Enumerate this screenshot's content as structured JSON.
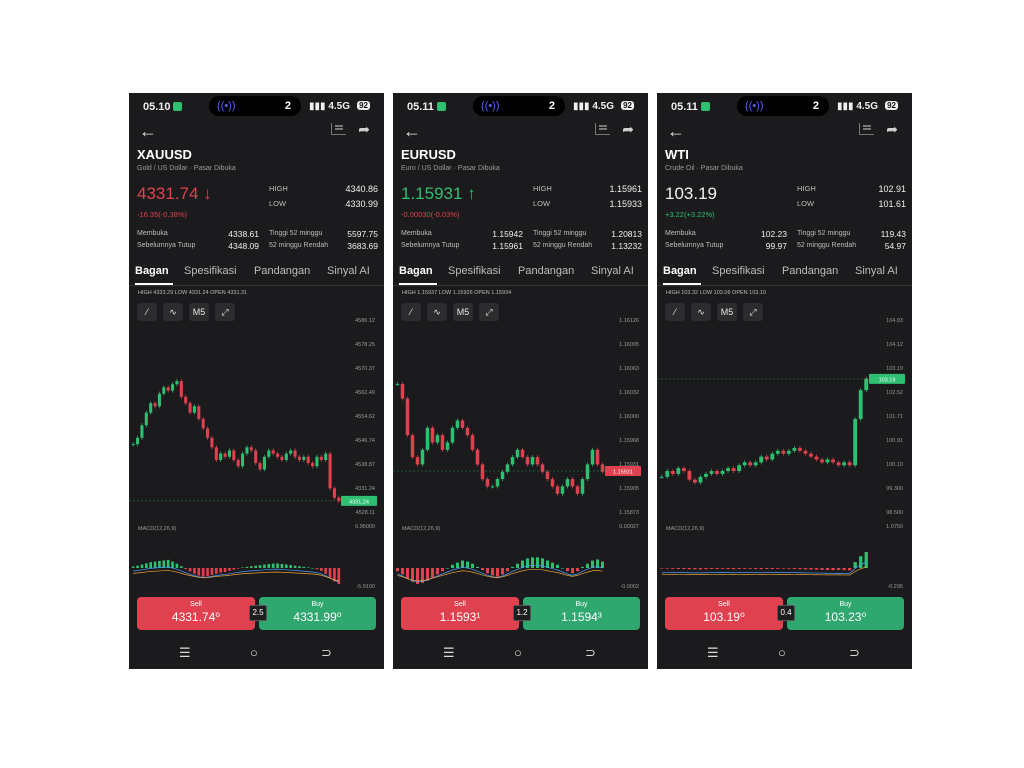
{
  "screens": [
    {
      "status": {
        "time": "05.10",
        "island_count": "2",
        "network": "4.5G",
        "battery": "92"
      },
      "symbol": "XAUUSD",
      "subtitle": "Gold / US Dollar · Pasar Dibuka",
      "price": "4331.74",
      "price_arrow": "↓",
      "change": "-16.35(-0.38%)",
      "trend": "down",
      "high_label": "HIGH",
      "high": "4340.86",
      "low_label": "LOW",
      "low": "4330.99",
      "stats": {
        "open_label": "Membuka",
        "open": "4338.61",
        "prev_label": "Sebelumnya Tutup",
        "prev": "4348.09",
        "hi52_label": "Tinggi 52 minggu",
        "hi52": "5597.75",
        "lo52_label": "52 minggu Rendah",
        "lo52": "3683.69"
      },
      "tabs": [
        "Bagan",
        "Spesifikasi",
        "Pandangan",
        "Sinyal AI"
      ],
      "ohlc": "HIGH 4333.29  LOW 4331.24  OPEN 4331.31",
      "tools": [
        "⁄",
        "∿",
        "M5",
        "⤢"
      ],
      "chart": {
        "y_labels": [
          "4586.12",
          "4578.25",
          "4570.37",
          "4562.49",
          "4554.62",
          "4546.74",
          "4538.87",
          "4331.24",
          "4528.11"
        ],
        "price_tag": "4331.24",
        "macd_label": "MACD(12,26,9)",
        "macd_top": "6.95009",
        "macd_bottom": "-5.9100",
        "series": [
          4550,
          4552,
          4556,
          4560,
          4563,
          4562,
          4566,
          4568,
          4567,
          4569,
          4570,
          4565,
          4563,
          4560,
          4562,
          4558,
          4555,
          4552,
          4549,
          4545,
          4547,
          4546,
          4548,
          4545,
          4543,
          4547,
          4549,
          4548,
          4544,
          4542,
          4546,
          4548,
          4547,
          4546,
          4545,
          4547,
          4548,
          4546,
          4545,
          4546,
          4544,
          4543,
          4546,
          4545,
          4547,
          4536,
          4533,
          4532
        ],
        "tag_value": 4532,
        "ymin": 4525,
        "ymax": 4590,
        "macd": [
          0.5,
          0.8,
          1.2,
          1.6,
          2.0,
          2.2,
          2.4,
          2.6,
          2.8,
          2.2,
          1.5,
          0.6,
          -0.4,
          -1.2,
          -2.0,
          -2.6,
          -3.0,
          -2.8,
          -2.4,
          -2.0,
          -1.6,
          -1.4,
          -1.0,
          -0.6,
          -0.2,
          0.2,
          0.4,
          0.6,
          0.8,
          1.0,
          1.2,
          1.4,
          1.5,
          1.6,
          1.4,
          1.2,
          1.0,
          0.8,
          0.6,
          0.4,
          0.2,
          0.0,
          -0.4,
          -1.0,
          -2.0,
          -3.4,
          -4.6,
          -5.5
        ]
      },
      "sell_label": "Sell",
      "sell_price": "4331.74⁰",
      "buy_label": "Buy",
      "buy_price": "4331.99⁰",
      "spread": "2.5",
      "nav": [
        "☰",
        "○",
        "⊃"
      ]
    },
    {
      "status": {
        "time": "05.11",
        "island_count": "2",
        "network": "4.5G",
        "battery": "92"
      },
      "symbol": "EURUSD",
      "subtitle": "Euro / US Dollar · Pasar Dibuka",
      "price": "1.15931",
      "price_arrow": "↑",
      "change": "-0.00030(-0.03%)",
      "trend": "up",
      "high_label": "HIGH",
      "high": "1.15961",
      "low_label": "LOW",
      "low": "1.15933",
      "stats": {
        "open_label": "Membuka",
        "open": "1.15942",
        "prev_label": "Sebelumnya Tutup",
        "prev": "1.15961",
        "hi52_label": "Tinggi 52 minggu",
        "hi52": "1.20813",
        "lo52_label": "52 minggu Rendah",
        "lo52": "1.13232"
      },
      "tabs": [
        "Bagan",
        "Spesifikasi",
        "Pandangan",
        "Sinyal AI"
      ],
      "ohlc": "HIGH 1.15937  LOW 1.15926  OPEN 1.15934",
      "tools": [
        "⁄",
        "∿",
        "M5",
        "⤢"
      ],
      "chart": {
        "y_labels": [
          "1.16126",
          "1.16095",
          "1.16063",
          "1.16032",
          "1.16000",
          "1.15968",
          "1.15931",
          "1.15905",
          "1.15873"
        ],
        "price_tag": "1.15931",
        "macd_label": "MACD(12,26,9)",
        "macd_top": "0.00027",
        "macd_bottom": "-0.0002",
        "series": [
          1.1605,
          1.1603,
          1.1598,
          1.1595,
          1.1594,
          1.1596,
          1.1599,
          1.1597,
          1.1598,
          1.1596,
          1.1597,
          1.1599,
          1.16,
          1.1599,
          1.1598,
          1.1596,
          1.1594,
          1.1592,
          1.1591,
          1.1591,
          1.1592,
          1.1593,
          1.1594,
          1.1595,
          1.1596,
          1.1595,
          1.1594,
          1.1595,
          1.1594,
          1.1593,
          1.1592,
          1.1591,
          1.159,
          1.1591,
          1.1592,
          1.1591,
          1.159,
          1.1592,
          1.1594,
          1.1596,
          1.1594,
          1.1593
        ],
        "tag_value": 1.15931,
        "ymin": 1.1586,
        "ymax": 1.1614,
        "macd": [
          -0.3,
          -0.6,
          -1.0,
          -1.3,
          -1.5,
          -1.4,
          -1.2,
          -0.9,
          -0.6,
          -0.3,
          0.0,
          0.3,
          0.5,
          0.7,
          0.6,
          0.4,
          0.1,
          -0.2,
          -0.5,
          -0.7,
          -0.8,
          -0.6,
          -0.3,
          0.1,
          0.4,
          0.7,
          0.9,
          1.0,
          1.0,
          0.9,
          0.7,
          0.5,
          0.3,
          0.0,
          -0.3,
          -0.5,
          -0.3,
          0.1,
          0.4,
          0.7,
          0.8,
          0.6
        ]
      },
      "sell_label": "Sell",
      "sell_price": "1.1593¹",
      "buy_label": "Buy",
      "buy_price": "1.1594³",
      "spread": "1.2",
      "nav": [
        "☰",
        "○",
        "⊃"
      ]
    },
    {
      "status": {
        "time": "05.11",
        "island_count": "2",
        "network": "4.5G",
        "battery": "92"
      },
      "symbol": "WTI",
      "subtitle": "Crude Oil · Pasar Dibuka",
      "price": "103.19",
      "price_arrow": "",
      "change": "+3.22(+3.22%)",
      "trend": "flat",
      "high_label": "HIGH",
      "high": "102.91",
      "low_label": "LOW",
      "low": "101.61",
      "stats": {
        "open_label": "Membuka",
        "open": "102.23",
        "prev_label": "Sebelumnya Tutup",
        "prev": "99.97",
        "hi52_label": "Tinggi 52 minggu",
        "hi52": "119.43",
        "lo52_label": "52 minggu Rendah",
        "lo52": "54.97"
      },
      "tabs": [
        "Bagan",
        "Spesifikasi",
        "Pandangan",
        "Sinyal AI"
      ],
      "ohlc": "HIGH 103.32  LOW 103.06  OPEN 103.10",
      "tools": [
        "⁄",
        "∿",
        "M5",
        "⤢"
      ],
      "chart": {
        "y_labels": [
          "104.93",
          "104.12",
          "103.19",
          "102.52",
          "101.71",
          "100.91",
          "100.10",
          "99.300",
          "98.500"
        ],
        "price_tag": "103.19",
        "macd_label": "MACD(12,26,9)",
        "macd_top": "1.0750",
        "macd_bottom": "-0.295",
        "series": [
          99.8,
          100.0,
          99.9,
          100.1,
          100.0,
          99.7,
          99.6,
          99.8,
          99.9,
          100.0,
          99.9,
          100.0,
          100.1,
          100.0,
          100.2,
          100.3,
          100.2,
          100.3,
          100.5,
          100.4,
          100.6,
          100.7,
          100.6,
          100.7,
          100.8,
          100.7,
          100.6,
          100.5,
          100.4,
          100.3,
          100.4,
          100.3,
          100.2,
          100.3,
          100.2,
          101.8,
          102.8,
          103.2
        ],
        "tag_value": 103.19,
        "ymin": 98.2,
        "ymax": 105.3,
        "macd": [
          -0.02,
          -0.04,
          -0.05,
          -0.06,
          -0.06,
          -0.07,
          -0.08,
          -0.08,
          -0.07,
          -0.06,
          -0.06,
          -0.05,
          -0.06,
          -0.07,
          -0.06,
          -0.05,
          -0.05,
          -0.06,
          -0.07,
          -0.06,
          -0.06,
          -0.05,
          -0.04,
          -0.05,
          -0.06,
          -0.07,
          -0.08,
          -0.09,
          -0.1,
          -0.11,
          -0.12,
          -0.13,
          -0.12,
          -0.13,
          -0.14,
          0.35,
          0.7,
          0.95
        ]
      },
      "sell_label": "Sell",
      "sell_price": "103.19⁰",
      "buy_label": "Buy",
      "buy_price": "103.23⁰",
      "spread": "0.4",
      "nav": [
        "☰",
        "○",
        "⊃"
      ]
    }
  ],
  "colors": {
    "bg": "#1b1b1d",
    "red": "#e0414f",
    "green": "#2fbf71",
    "buy": "#2fa870"
  }
}
